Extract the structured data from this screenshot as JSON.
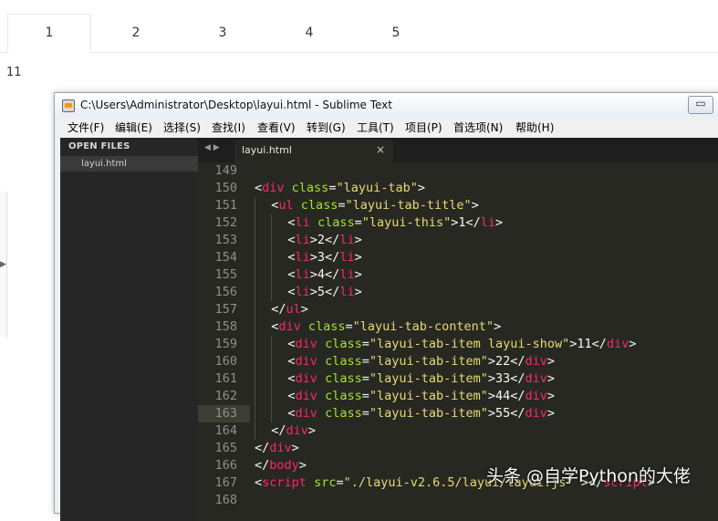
{
  "browser": {
    "tabs": [
      "1",
      "2",
      "3",
      "4",
      "5"
    ],
    "active_tab": 0,
    "content": "11"
  },
  "window": {
    "title": "C:\\Users\\Administrator\\Desktop\\layui.html - Sublime Text",
    "minimize_glyph": "▭"
  },
  "menu": [
    "文件(F)",
    "编辑(E)",
    "选择(S)",
    "查找(I)",
    "查看(V)",
    "转到(G)",
    "工具(T)",
    "项目(P)",
    "首选项(N)",
    "帮助(H)"
  ],
  "sidebar": {
    "header": "OPEN FILES",
    "files": [
      "layui.html"
    ]
  },
  "editor": {
    "tab_arrows": "◀ ▶",
    "tab_label": "layui.html",
    "tab_close": "×",
    "current_line": 163,
    "lines": [
      {
        "n": "149",
        "indent": 0,
        "tokens": []
      },
      {
        "n": "150",
        "indent": 0,
        "tokens": [
          [
            "p",
            "<"
          ],
          [
            "t",
            "div"
          ],
          [
            "p",
            " "
          ],
          [
            "a",
            "class"
          ],
          [
            "p",
            "="
          ],
          [
            "s",
            "\"layui-tab\""
          ],
          [
            "p",
            ">"
          ]
        ]
      },
      {
        "n": "151",
        "indent": 1,
        "tokens": [
          [
            "p",
            "<"
          ],
          [
            "t",
            "ul"
          ],
          [
            "p",
            " "
          ],
          [
            "a",
            "class"
          ],
          [
            "p",
            "="
          ],
          [
            "s",
            "\"layui-tab-title\""
          ],
          [
            "p",
            ">"
          ]
        ]
      },
      {
        "n": "152",
        "indent": 2,
        "tokens": [
          [
            "p",
            "<"
          ],
          [
            "t",
            "li"
          ],
          [
            "p",
            " "
          ],
          [
            "a",
            "class"
          ],
          [
            "p",
            "="
          ],
          [
            "s",
            "\"layui-this\""
          ],
          [
            "p",
            ">1</"
          ],
          [
            "t",
            "li"
          ],
          [
            "p",
            ">"
          ]
        ]
      },
      {
        "n": "153",
        "indent": 2,
        "tokens": [
          [
            "p",
            "<"
          ],
          [
            "t",
            "li"
          ],
          [
            "p",
            ">2</"
          ],
          [
            "t",
            "li"
          ],
          [
            "p",
            ">"
          ]
        ]
      },
      {
        "n": "154",
        "indent": 2,
        "tokens": [
          [
            "p",
            "<"
          ],
          [
            "t",
            "li"
          ],
          [
            "p",
            ">3</"
          ],
          [
            "t",
            "li"
          ],
          [
            "p",
            ">"
          ]
        ]
      },
      {
        "n": "155",
        "indent": 2,
        "tokens": [
          [
            "p",
            "<"
          ],
          [
            "t",
            "li"
          ],
          [
            "p",
            ">4</"
          ],
          [
            "t",
            "li"
          ],
          [
            "p",
            ">"
          ]
        ]
      },
      {
        "n": "156",
        "indent": 2,
        "tokens": [
          [
            "p",
            "<"
          ],
          [
            "t",
            "li"
          ],
          [
            "p",
            ">5</"
          ],
          [
            "t",
            "li"
          ],
          [
            "p",
            ">"
          ]
        ]
      },
      {
        "n": "157",
        "indent": 1,
        "tokens": [
          [
            "p",
            "</"
          ],
          [
            "t",
            "ul"
          ],
          [
            "p",
            ">"
          ]
        ]
      },
      {
        "n": "158",
        "indent": 1,
        "tokens": [
          [
            "p",
            "<"
          ],
          [
            "t",
            "div"
          ],
          [
            "p",
            " "
          ],
          [
            "a",
            "class"
          ],
          [
            "p",
            "="
          ],
          [
            "s",
            "\"layui-tab-content\""
          ],
          [
            "p",
            ">"
          ]
        ]
      },
      {
        "n": "159",
        "indent": 2,
        "tokens": [
          [
            "p",
            "<"
          ],
          [
            "t",
            "div"
          ],
          [
            "p",
            " "
          ],
          [
            "a",
            "class"
          ],
          [
            "p",
            "="
          ],
          [
            "s",
            "\"layui-tab-item layui-show\""
          ],
          [
            "p",
            ">11</"
          ],
          [
            "t",
            "div"
          ],
          [
            "p",
            ">"
          ]
        ]
      },
      {
        "n": "160",
        "indent": 2,
        "tokens": [
          [
            "p",
            "<"
          ],
          [
            "t",
            "div"
          ],
          [
            "p",
            " "
          ],
          [
            "a",
            "class"
          ],
          [
            "p",
            "="
          ],
          [
            "s",
            "\"layui-tab-item\""
          ],
          [
            "p",
            ">22</"
          ],
          [
            "t",
            "div"
          ],
          [
            "p",
            ">"
          ]
        ]
      },
      {
        "n": "161",
        "indent": 2,
        "tokens": [
          [
            "p",
            "<"
          ],
          [
            "t",
            "div"
          ],
          [
            "p",
            " "
          ],
          [
            "a",
            "class"
          ],
          [
            "p",
            "="
          ],
          [
            "s",
            "\"layui-tab-item\""
          ],
          [
            "p",
            ">33</"
          ],
          [
            "t",
            "div"
          ],
          [
            "p",
            ">"
          ]
        ]
      },
      {
        "n": "162",
        "indent": 2,
        "tokens": [
          [
            "p",
            "<"
          ],
          [
            "t",
            "div"
          ],
          [
            "p",
            " "
          ],
          [
            "a",
            "class"
          ],
          [
            "p",
            "="
          ],
          [
            "s",
            "\"layui-tab-item\""
          ],
          [
            "p",
            ">44</"
          ],
          [
            "t",
            "div"
          ],
          [
            "p",
            ">"
          ]
        ]
      },
      {
        "n": "163",
        "indent": 2,
        "tokens": [
          [
            "p",
            "<"
          ],
          [
            "t",
            "div"
          ],
          [
            "p",
            " "
          ],
          [
            "a",
            "class"
          ],
          [
            "p",
            "="
          ],
          [
            "s",
            "\"layui-tab-item\""
          ],
          [
            "p",
            ">55</"
          ],
          [
            "t",
            "div"
          ],
          [
            "p",
            ">"
          ]
        ]
      },
      {
        "n": "164",
        "indent": 1,
        "tokens": [
          [
            "p",
            "</"
          ],
          [
            "t",
            "div"
          ],
          [
            "p",
            ">"
          ]
        ]
      },
      {
        "n": "165",
        "indent": 0,
        "tokens": [
          [
            "p",
            "</"
          ],
          [
            "t",
            "div"
          ],
          [
            "p",
            ">"
          ]
        ]
      },
      {
        "n": "166",
        "indent": 0,
        "tokens": [
          [
            "p",
            "</"
          ],
          [
            "t",
            "body"
          ],
          [
            "p",
            ">"
          ]
        ]
      },
      {
        "n": "167",
        "indent": 0,
        "tokens": [
          [
            "p",
            "<"
          ],
          [
            "t",
            "script"
          ],
          [
            "p",
            " "
          ],
          [
            "a",
            "src"
          ],
          [
            "p",
            "="
          ],
          [
            "s",
            "\"./layui-v2.6.5/layui/layui.js\""
          ],
          [
            "p",
            " ></"
          ],
          [
            "t",
            "script"
          ],
          [
            "p",
            ">"
          ]
        ]
      },
      {
        "n": "168",
        "indent": 0,
        "tokens": []
      }
    ]
  },
  "watermark": "头条 @自学Python的大佬"
}
